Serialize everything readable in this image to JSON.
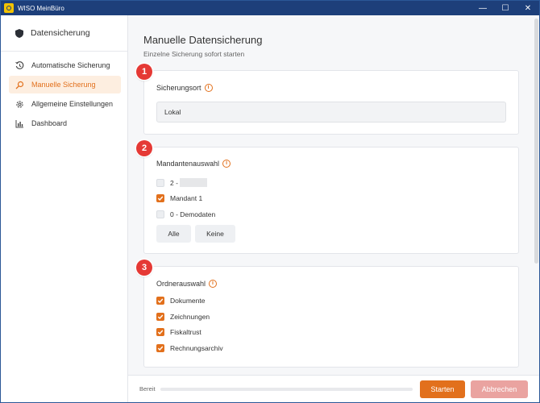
{
  "window": {
    "title": "WISO MeinBüro",
    "controls": {
      "minimize": "—",
      "maximize": "☐",
      "close": "✕"
    }
  },
  "sidebar": {
    "header": {
      "icon": "shield-icon",
      "label": "Datensicherung"
    },
    "items": [
      {
        "icon": "history-icon",
        "label": "Automatische Sicherung",
        "active": false
      },
      {
        "icon": "search-icon",
        "label": "Manuelle Sicherung",
        "active": true
      },
      {
        "icon": "gear-icon",
        "label": "Allgemeine Einstellungen",
        "active": false
      },
      {
        "icon": "bar-chart-icon",
        "label": "Dashboard",
        "active": false
      }
    ]
  },
  "main": {
    "title": "Manuelle Datensicherung",
    "subtitle": "Einzelne Sicherung sofort starten",
    "sections": [
      {
        "badge": "1",
        "title": "Sicherungsort",
        "value": "Lokal"
      },
      {
        "badge": "2",
        "title": "Mandantenauswahl",
        "options": [
          {
            "label": "2 -",
            "checked": false,
            "redacted": true
          },
          {
            "label": "Mandant 1",
            "checked": true
          },
          {
            "label": "0 - Demodaten",
            "checked": false
          }
        ],
        "buttons": {
          "all": "Alle",
          "none": "Keine"
        }
      },
      {
        "badge": "3",
        "title": "Ordnerauswahl",
        "options": [
          {
            "label": "Dokumente",
            "checked": true
          },
          {
            "label": "Zeichnungen",
            "checked": true
          },
          {
            "label": "Fiskaltrust",
            "checked": true
          },
          {
            "label": "Rechnungsarchiv",
            "checked": true
          }
        ]
      }
    ]
  },
  "footer": {
    "status": "Bereit",
    "progress": 0,
    "start_label": "Starten",
    "cancel_label": "Abbrechen"
  },
  "colors": {
    "accent": "#e2701c",
    "titlebar": "#1d3f7a",
    "badge": "#e53935",
    "cancel_disabled": "#eaa3a0"
  }
}
